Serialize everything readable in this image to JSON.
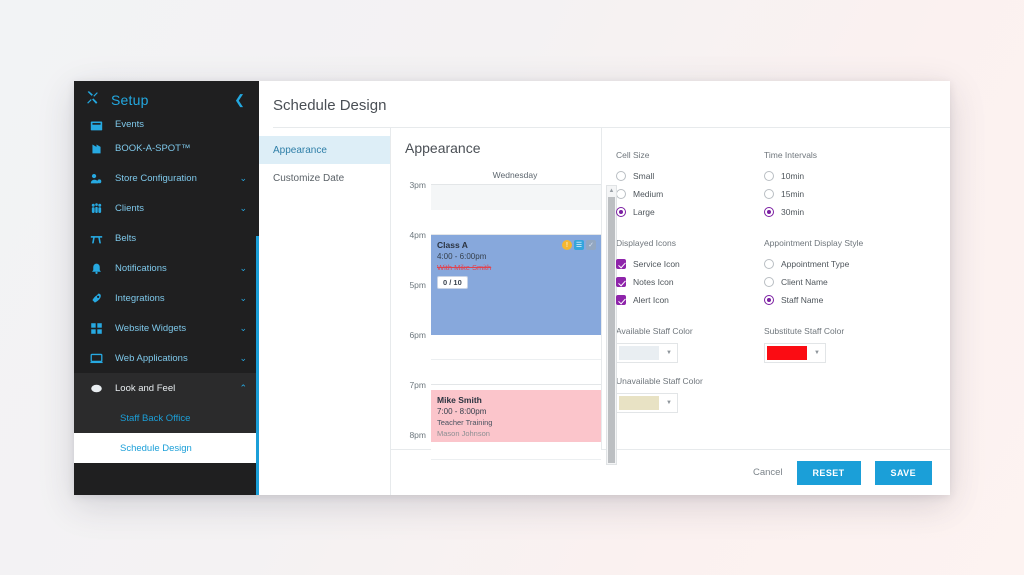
{
  "sidebar": {
    "brand": "Setup",
    "collapse_icon": "chevron-left-icon",
    "items": [
      {
        "label": "Events",
        "icon": "events-icon",
        "caret": "",
        "clipped": true
      },
      {
        "label": "BOOK-A-SPOT™",
        "icon": "book-a-spot-icon",
        "caret": ""
      },
      {
        "label": "Store Configuration",
        "icon": "store-icon",
        "caret": "⌄"
      },
      {
        "label": "Clients",
        "icon": "clients-icon",
        "caret": "⌄"
      },
      {
        "label": "Belts",
        "icon": "belts-icon",
        "caret": ""
      },
      {
        "label": "Notifications",
        "icon": "bell-icon",
        "caret": "⌄"
      },
      {
        "label": "Integrations",
        "icon": "integrations-icon",
        "caret": "⌄"
      },
      {
        "label": "Website Widgets",
        "icon": "widgets-icon",
        "caret": "⌄"
      },
      {
        "label": "Web Applications",
        "icon": "web-apps-icon",
        "caret": "⌄"
      }
    ],
    "expanded": {
      "label": "Look and Feel",
      "icon": "look-and-feel-icon",
      "caret": "⌃"
    },
    "sub_items": [
      {
        "label": "Staff Back Office",
        "active": false
      },
      {
        "label": "Schedule Design",
        "active": true
      }
    ]
  },
  "header": {
    "title": "Schedule Design"
  },
  "tabs": [
    {
      "label": "Appearance",
      "active": true
    },
    {
      "label": "Customize Date",
      "active": false
    }
  ],
  "panel": {
    "heading": "Appearance"
  },
  "calendar": {
    "day_label": "Wednesday",
    "times": [
      "3pm",
      "4pm",
      "5pm",
      "6pm",
      "7pm",
      "8pm"
    ],
    "scroll_up_icon": "scroll-up-arrow-icon",
    "events": [
      {
        "title": "Class A",
        "time": "4:00 - 6:00pm",
        "staff": "With Mike Smith",
        "count": "0 / 10",
        "color": "#87a8dc",
        "icons": [
          "alert-icon",
          "notes-icon",
          "service-icon"
        ]
      },
      {
        "title": "Mike Smith",
        "time": "7:00 - 8:00pm",
        "type": "Teacher Training",
        "client": "Mason Johnson",
        "color": "#fbc5cb"
      }
    ]
  },
  "settings": {
    "cell_size": {
      "label": "Cell Size",
      "options": [
        {
          "label": "Small",
          "selected": false
        },
        {
          "label": "Medium",
          "selected": false
        },
        {
          "label": "Large",
          "selected": true
        }
      ]
    },
    "time_intervals": {
      "label": "Time Intervals",
      "options": [
        {
          "label": "10min",
          "selected": false
        },
        {
          "label": "15min",
          "selected": false
        },
        {
          "label": "30min",
          "selected": true
        }
      ]
    },
    "displayed_icons": {
      "label": "Displayed Icons",
      "options": [
        {
          "label": "Service Icon",
          "checked": true
        },
        {
          "label": "Notes Icon",
          "checked": true
        },
        {
          "label": "Alert Icon",
          "checked": true
        }
      ]
    },
    "appointment_display_style": {
      "label": "Appointment Display Style",
      "options": [
        {
          "label": "Appointment Type",
          "selected": false
        },
        {
          "label": "Client Name",
          "selected": false
        },
        {
          "label": "Staff Name",
          "selected": true
        }
      ]
    },
    "available_staff_color": {
      "label": "Available Staff Color",
      "value": "#e9eef2"
    },
    "substitute_staff_color": {
      "label": "Substitute Staff Color",
      "value": "#fb0c13"
    },
    "unavailable_staff_color": {
      "label": "Unavailable Staff Color",
      "value": "#e8e2c4"
    },
    "accent_color": "#8e24aa"
  },
  "footer": {
    "cancel_label": "Cancel",
    "reset_label": "RESET",
    "save_label": "SAVE"
  }
}
